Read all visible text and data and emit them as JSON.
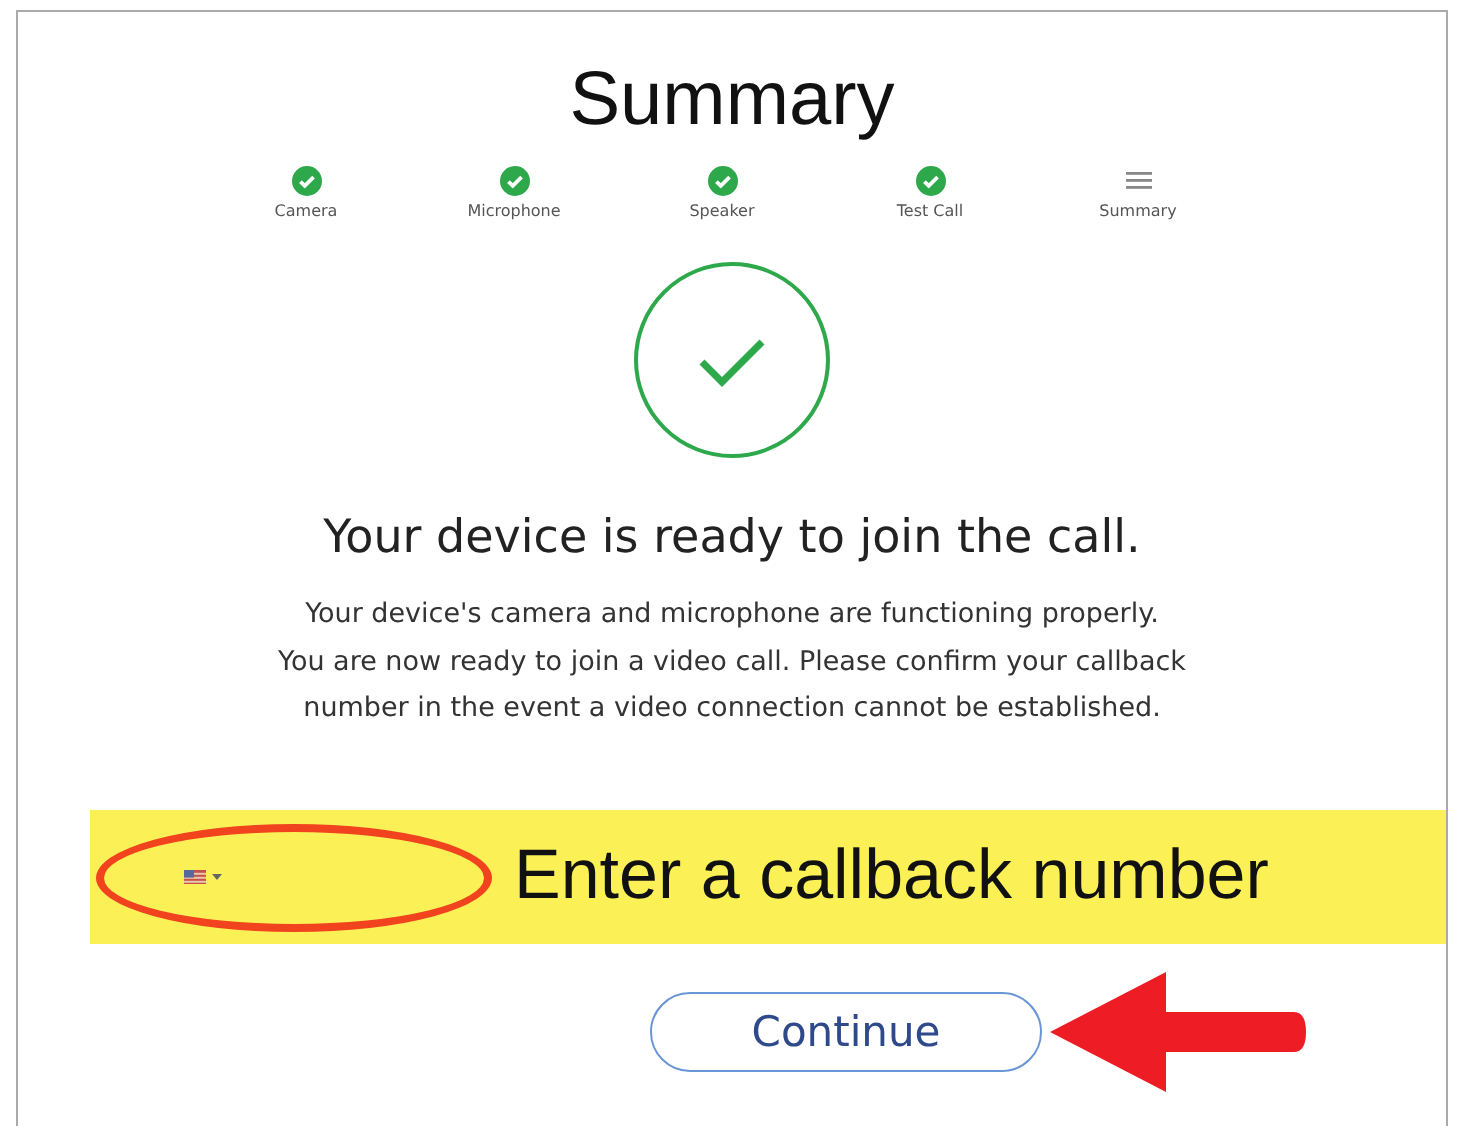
{
  "title": "Summary",
  "steps": [
    {
      "label": "Camera",
      "done": true
    },
    {
      "label": "Microphone",
      "done": true
    },
    {
      "label": "Speaker",
      "done": true
    },
    {
      "label": "Test Call",
      "done": true
    },
    {
      "label": "Summary",
      "done": false
    }
  ],
  "status": {
    "heading": "Your device is ready to join the call.",
    "lines": [
      "Your device's camera and microphone are functioning properly.",
      "You are now ready to join a video call. Please confirm your callback",
      "number in the event a video connection cannot be established."
    ]
  },
  "callback": {
    "annotation": "Enter a callback number"
  },
  "buttons": [
    {
      "label": "Continue"
    }
  ]
}
